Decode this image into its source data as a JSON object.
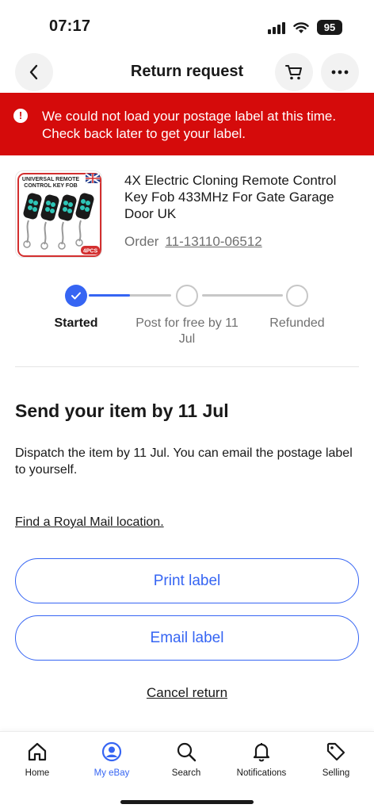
{
  "status_bar": {
    "time": "07:17",
    "battery": "95"
  },
  "header": {
    "title": "Return request",
    "icons": {
      "back": "chevron-left-icon",
      "cart": "cart-icon",
      "more": "more-horizontal-icon"
    }
  },
  "error_banner": {
    "icon": "!",
    "message": "We could not load your postage label at this time. Check back later to get your label."
  },
  "item": {
    "image_text": {
      "line1": "UNIVERSAL REMOTE",
      "line2": "CONTROL KEY FOB",
      "badge": "4PCS"
    },
    "title": "4X Electric Cloning Remote Control Key Fob 433MHz For Gate Garage Door UK",
    "order_label": "Order",
    "order_number": "11-13110-06512"
  },
  "progress": {
    "steps": [
      {
        "label": "Started",
        "status": "done"
      },
      {
        "label": "Post for free by 11 Jul",
        "status": "todo"
      },
      {
        "label": "Refunded",
        "status": "todo"
      }
    ],
    "fill_fraction_first_segment": 0.5
  },
  "main": {
    "section_title": "Send your item by 11 Jul",
    "description": "Dispatch the item by 11 Jul. You can email the postage label to yourself.",
    "royal_mail_link": "Find a Royal Mail location.",
    "print_label": "Print label",
    "email_label": "Email label",
    "cancel_return": "Cancel return"
  },
  "tab_bar": {
    "tabs": [
      {
        "label": "Home",
        "icon": "home-icon"
      },
      {
        "label": "My eBay",
        "icon": "user-icon",
        "active": true
      },
      {
        "label": "Search",
        "icon": "search-icon"
      },
      {
        "label": "Notifications",
        "icon": "bell-icon"
      },
      {
        "label": "Selling",
        "icon": "tag-icon"
      }
    ]
  },
  "colors": {
    "accent": "#3665f3",
    "error": "#d50b0b",
    "text": "#191919",
    "muted": "#707070"
  }
}
